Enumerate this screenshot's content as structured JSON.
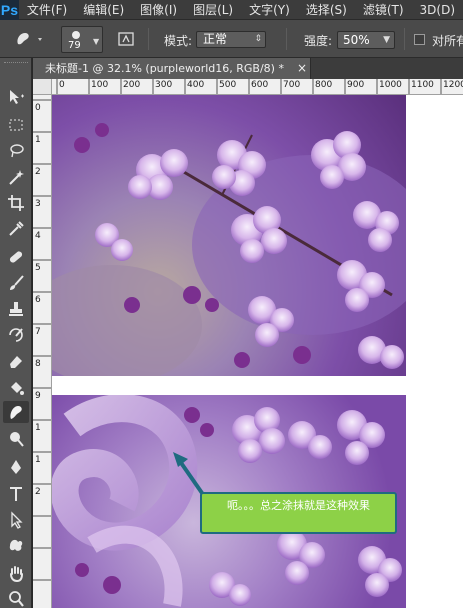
{
  "app": {
    "logo": "Ps"
  },
  "menu": [
    "文件(F)",
    "编辑(E)",
    "图像(I)",
    "图层(L)",
    "文字(Y)",
    "选择(S)",
    "滤镜(T)",
    "3D(D)"
  ],
  "options": {
    "brush_size": "79",
    "mode_label": "模式:",
    "mode_value": "正常",
    "strength_label": "强度:",
    "strength_value": "50%",
    "sample_all_label": "对所有"
  },
  "document": {
    "tab_title": "未标题-1 @ 32.1% (purpleworld16, RGB/8) *",
    "close_glyph": "×"
  },
  "ruler_top": [
    "0",
    "100",
    "200",
    "300",
    "400",
    "500",
    "600",
    "700",
    "800",
    "900",
    "1000",
    "1100",
    "1200"
  ],
  "ruler_left": [
    "0",
    "1",
    "2",
    "3",
    "4",
    "5",
    "6",
    "7",
    "8",
    "9",
    "1",
    "1",
    "2"
  ],
  "annotation": {
    "text": "呃。。。总之涂抹就是这种效果"
  },
  "colors": {
    "callout_fill": "#8dd147",
    "callout_border": "#1f6b80",
    "arrow": "#1f6b80"
  }
}
